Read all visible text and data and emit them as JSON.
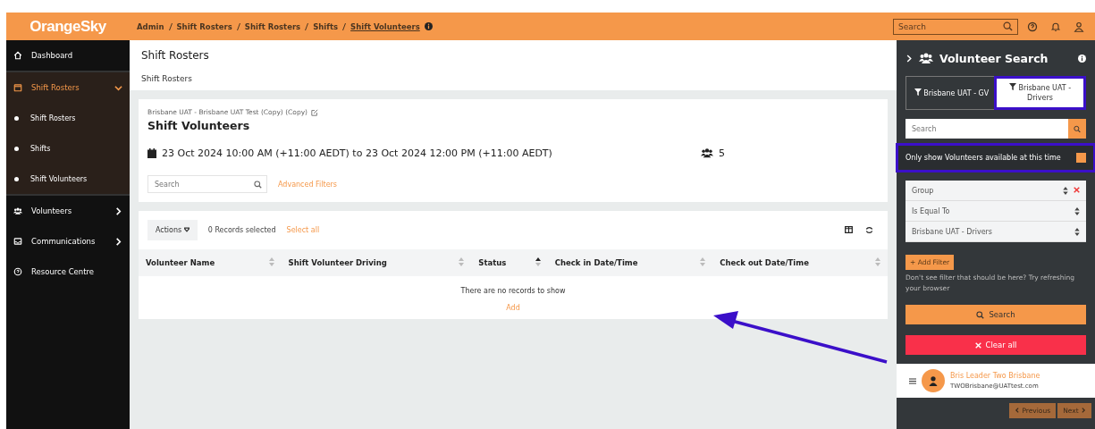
{
  "header": {
    "logo": "OrangeSky",
    "breadcrumbs": [
      {
        "label": "Admin",
        "current": false
      },
      {
        "label": "Shift Rosters",
        "current": false
      },
      {
        "label": "Shift Rosters",
        "current": false
      },
      {
        "label": "Shifts",
        "current": false
      },
      {
        "label": "Shift Volunteers",
        "current": true
      }
    ],
    "search": {
      "placeholder": "Search"
    }
  },
  "sidebar": {
    "items": [
      {
        "label": "Dashboard",
        "selected": false
      },
      {
        "label": "Shift Rosters",
        "selected": true,
        "expanded": true,
        "children": [
          {
            "label": "Shift Rosters",
            "selected": false
          },
          {
            "label": "Shifts",
            "selected": false
          },
          {
            "label": "Shift Volunteers",
            "selected": false
          }
        ]
      },
      {
        "label": "Volunteers",
        "selected": false,
        "expanded": false
      },
      {
        "label": "Communications",
        "selected": false,
        "expanded": false
      },
      {
        "label": "Resource Centre",
        "selected": false
      }
    ]
  },
  "page": {
    "title": "Shift Rosters",
    "subtitle": "Shift Rosters"
  },
  "shift": {
    "context": "Brisbane UAT - Brisbane UAT Test (Copy) (Copy)",
    "title": "Shift Volunteers",
    "time": "23 Oct 2024 10:00 AM (+11:00 AEDT) to 23 Oct 2024 12:00 PM (+11:00 AEDT)",
    "volunteer_count": "5",
    "search": {
      "placeholder": "Search"
    },
    "advanced_filters": "Advanced Filters"
  },
  "table": {
    "actions": "Actions",
    "records_selected": "0 Records selected",
    "select_all": "Select all",
    "columns": [
      {
        "label": "Volunteer Name",
        "sorted": false
      },
      {
        "label": "Shift Volunteer Driving",
        "sorted": false
      },
      {
        "label": "Status",
        "sorted": true
      },
      {
        "label": "Check in Date/Time",
        "sorted": false
      },
      {
        "label": "Check out Date/Time",
        "sorted": false
      }
    ],
    "empty_message": "There are no records to show",
    "add": "Add"
  },
  "volunteer_search": {
    "title": "Volunteer Search",
    "filter_tabs": [
      {
        "label": "Brisbane UAT - GV",
        "selected": false,
        "highlighted": false
      },
      {
        "label": "Brisbane UAT - Drivers",
        "selected": true,
        "highlighted": true
      }
    ],
    "search": {
      "placeholder": "Search"
    },
    "available_only": {
      "label": "Only show Volunteers available at this time",
      "checked": true,
      "highlighted": true
    },
    "filters": [
      {
        "value": "Group",
        "removable": true
      },
      {
        "value": "Is Equal To",
        "removable": false
      },
      {
        "value": "Brisbane UAT - Drivers",
        "removable": false
      }
    ],
    "add_filter": "+ Add Filter",
    "hint": "Don't see filter that should be here? Try refreshing your browser",
    "search_button": "Search",
    "clear_button": "Clear all",
    "results": [
      {
        "name": "Bris Leader Two Brisbane",
        "email": "TWOBrisbane@UATtest.com"
      }
    ],
    "pagination": {
      "previous": "Previous",
      "next": "Next"
    }
  }
}
